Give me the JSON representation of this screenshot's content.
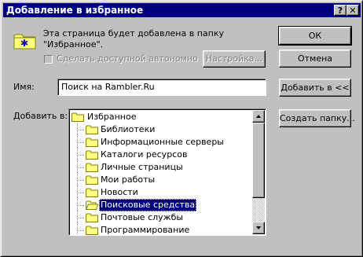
{
  "window": {
    "title": "Добавление в избранное",
    "help_label": "?",
    "close_label": "✕"
  },
  "message": {
    "line1": "Эта страница будет добавлена в папку",
    "line2": "\"Избранное\"."
  },
  "offline_checkbox": {
    "label": "Сделать доступной автономно",
    "checked": false
  },
  "buttons": {
    "ok": "ОК",
    "cancel": "Отмена",
    "customize": "Настройка...",
    "add_to": "Добавить в <<",
    "new_folder": "Создать папку..."
  },
  "name_field": {
    "label": "Имя:",
    "value": "Поиск на Rambler.Ru"
  },
  "tree": {
    "label": "Добавить в:",
    "root": "Избранное",
    "items": [
      "Библиотеки",
      "Информационные серверы",
      "Каталоги ресурсов",
      "Личные страницы",
      "Мои работы",
      "Новости",
      "Поисковые средства",
      "Почтовые службы",
      "Программирование"
    ],
    "selected": "Поисковые средства"
  },
  "scrollbar": {
    "position": 0.0,
    "visible_fraction": 0.76
  }
}
